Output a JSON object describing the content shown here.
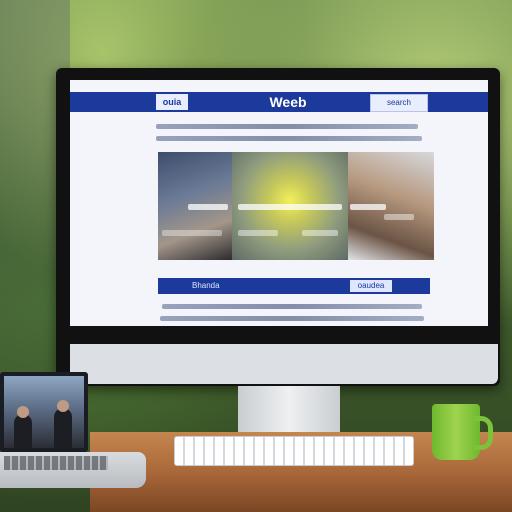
{
  "website": {
    "logo_text": "ouia",
    "title": "Weeb",
    "search_text": "search",
    "gallery": {
      "photos": [
        {
          "name": "photo-people"
        },
        {
          "name": "photo-glowing-lamp"
        },
        {
          "name": "photo-kitchen"
        }
      ]
    },
    "midbar": {
      "left_label": "Bhanda",
      "right_button": "oaudea"
    }
  },
  "colors": {
    "brand_blue": "#1b3a9c",
    "page_background": "#f3f5fa",
    "mug_green": "#8cc63f",
    "desk_wood": "#a9683a"
  }
}
